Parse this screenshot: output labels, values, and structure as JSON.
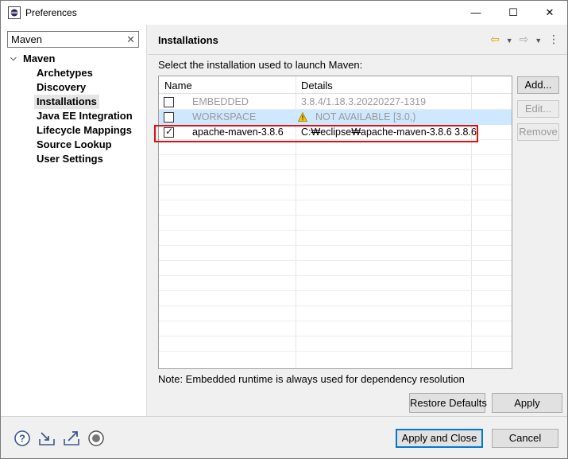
{
  "window": {
    "title": "Preferences",
    "controls": {
      "minimize": "—",
      "maximize": "☐",
      "close": "✕"
    }
  },
  "sidebar": {
    "filter_value": "Maven",
    "clear_icon": "✕",
    "root": {
      "label": "Maven",
      "expanded": true
    },
    "items": [
      {
        "label": "Archetypes"
      },
      {
        "label": "Discovery"
      },
      {
        "label": "Installations",
        "selected": true
      },
      {
        "label": "Java EE Integration"
      },
      {
        "label": "Lifecycle Mappings"
      },
      {
        "label": "Source Lookup"
      },
      {
        "label": "User Settings"
      }
    ]
  },
  "main": {
    "title": "Installations",
    "instructions": "Select the installation used to launch Maven:",
    "table": {
      "columns": [
        "Name",
        "Details"
      ],
      "rows": [
        {
          "name": "EMBEDDED",
          "details": "3.8.4/1.18.3.20220227-1319",
          "checked": false,
          "enabled": false
        },
        {
          "name": "WORKSPACE",
          "details": "NOT AVAILABLE [3.0,)",
          "checked": false,
          "enabled": false,
          "warning": true
        },
        {
          "name": "apache-maven-3.8.6",
          "details": "C:₩eclipse₩apache-maven-3.8.6 3.8.6",
          "checked": true,
          "enabled": true
        }
      ]
    },
    "buttons": {
      "add": "Add...",
      "edit": "Edit...",
      "remove": "Remove"
    },
    "note": "Note: Embedded runtime is always used for dependency resolution",
    "restore_defaults": "Restore Defaults",
    "apply": "Apply"
  },
  "footer": {
    "apply_and_close": "Apply and Close",
    "cancel": "Cancel",
    "icons": [
      "help-icon",
      "import-icon",
      "export-icon",
      "record-icon"
    ]
  },
  "colors": {
    "selection": "#cde8ff",
    "highlight": "#e01010",
    "default_button_border": "#0078d7"
  }
}
